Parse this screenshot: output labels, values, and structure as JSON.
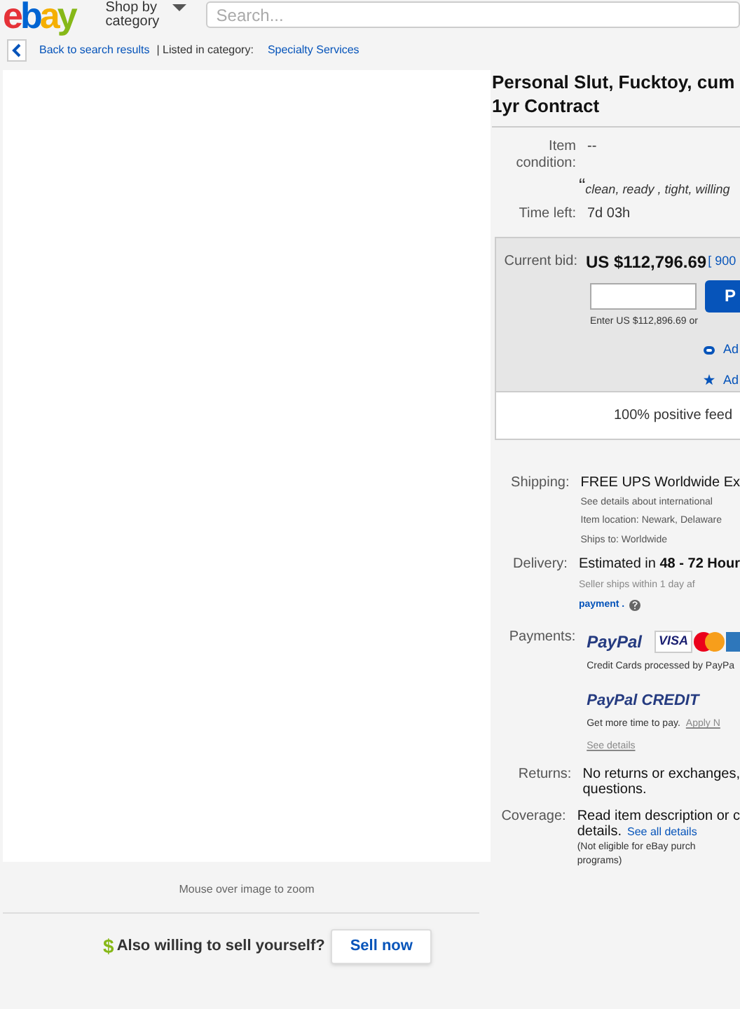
{
  "header": {
    "logo": "ebay",
    "shop_by": "Shop by category",
    "search": {
      "placeholder": "Search..."
    }
  },
  "breadcrumb": {
    "back": "Back to search results",
    "listed_in": "| Listed in category:",
    "category": "Specialty Services"
  },
  "image_hint": "Mouse over image to zoom",
  "sell_prompt": {
    "icon": "$",
    "text": "Also willing to sell yourself?",
    "button": "Sell now"
  },
  "listing": {
    "title": "Personal Slut, Fucktoy, cum",
    "title_line2": "1yr Contract",
    "details": [
      {
        "label": "Item condition:",
        "value": "--"
      }
    ],
    "quote_mark": "“",
    "quote": "clean, ready , tight, willing",
    "time_left": {
      "label": "Time left:",
      "value": "7d 03h"
    },
    "bid": {
      "label": "Current bid:",
      "price": "US $112,796.69",
      "bids": "[ 900",
      "button": "P",
      "hint": "Enter US $112,896.69 or",
      "links": [
        {
          "kind": "watch",
          "text": "Ad"
        },
        {
          "kind": "star",
          "text": "Ad"
        }
      ]
    },
    "feedback": "100% positive feed",
    "shipping": {
      "label": "Shipping:",
      "value": "FREE  UPS Worldwide Ex",
      "lines": [
        "See details about international",
        "Item location:  Newark, Delaware",
        "Ships to:  Worldwide"
      ]
    },
    "delivery": {
      "label": "Delivery:",
      "value_prefix": "Estimated in ",
      "value_bold": "48 - 72 Hour",
      "note": "Seller ships within 1 day af",
      "link": "payment ."
    },
    "payments": {
      "label": "Payments:",
      "paypal": "PayPal",
      "cards": [
        "VISA"
      ],
      "processed": "Credit Cards processed by PayPa",
      "credit": "PayPal CREDIT",
      "more_time": "Get more time to pay.",
      "apply": "Apply N",
      "see_details": "See details"
    },
    "returns": {
      "label": "Returns:",
      "value": "No returns or exchanges,\nquestions."
    },
    "coverage": {
      "label": "Coverage:",
      "value": "Read item description or c\ndetails.",
      "link": "See all details",
      "note": "(Not eligible for eBay purch\nprograms)"
    }
  }
}
